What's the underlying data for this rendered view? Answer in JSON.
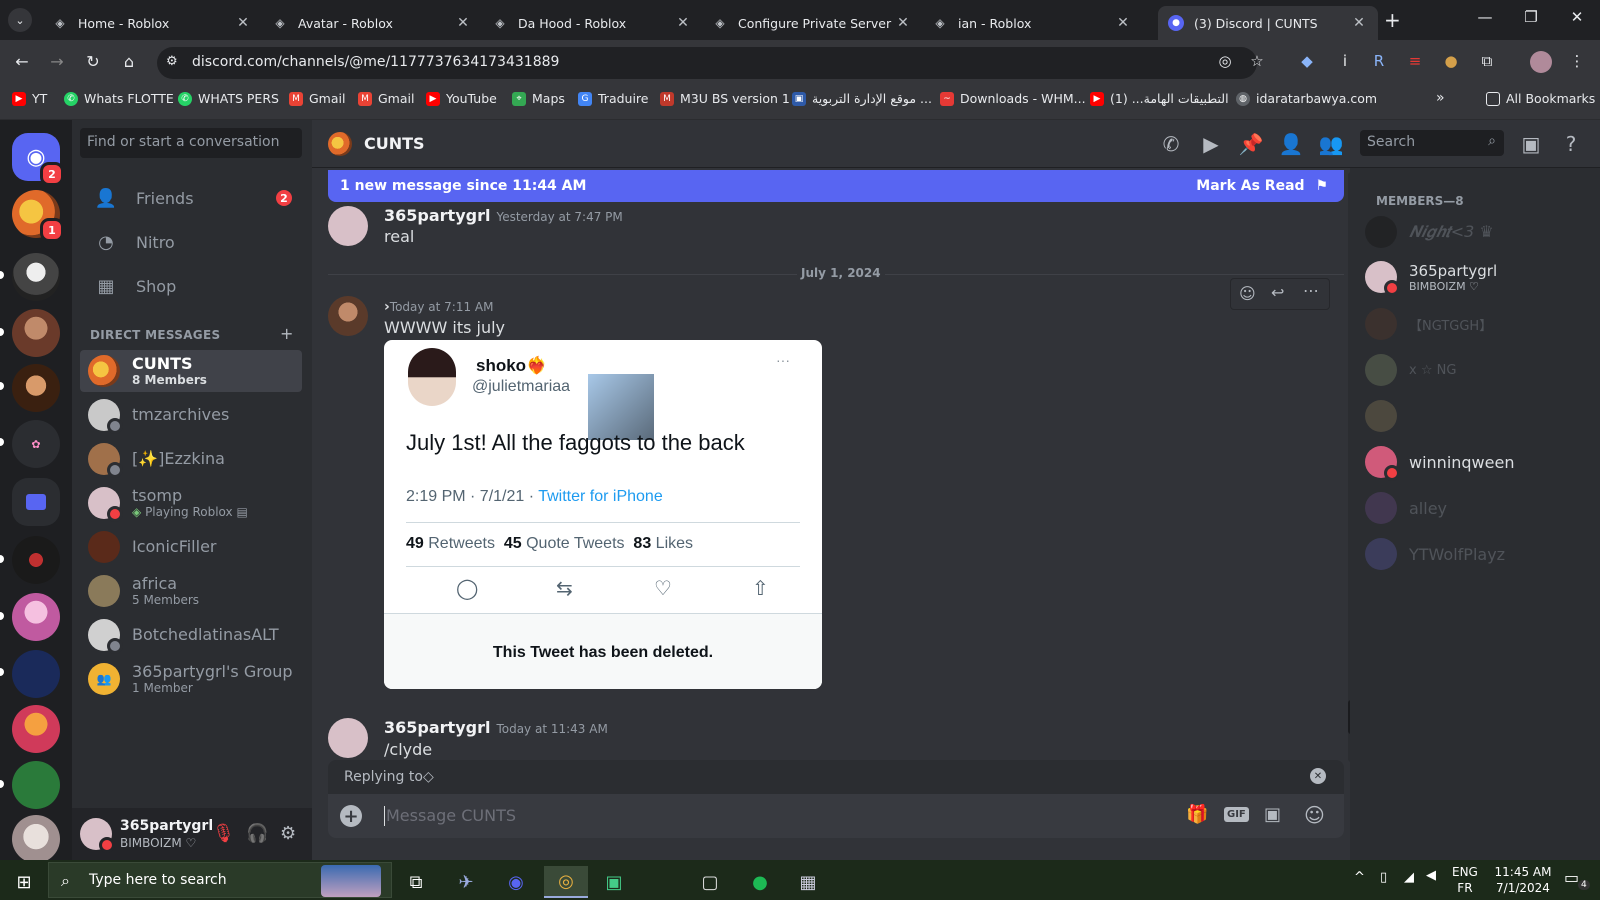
{
  "browser": {
    "tabs": [
      {
        "title": "Home - Roblox",
        "icon": "roblox-icon"
      },
      {
        "title": "Avatar - Roblox",
        "icon": "roblox-icon"
      },
      {
        "title": "Da Hood - Roblox",
        "icon": "roblox-icon"
      },
      {
        "title": "Configure Private Server - Ro",
        "icon": "roblox-icon"
      },
      {
        "title": "ian - Roblox",
        "icon": "roblox-icon"
      },
      {
        "title": "(3) Discord | CUNTS",
        "icon": "discord-icon",
        "active": true
      }
    ],
    "new_tab": "+",
    "url": "discord.com/channels/@me/1177737634173431889",
    "bookmarks": [
      {
        "label": "YT",
        "color": "#ff0000"
      },
      {
        "label": "Whats FLOTTE",
        "color": "#25d366"
      },
      {
        "label": "WHATS  PERS",
        "color": "#25d366"
      },
      {
        "label": "Gmail",
        "color": "#ea4335"
      },
      {
        "label": "Gmail",
        "color": "#ea4335"
      },
      {
        "label": "YouTube",
        "color": "#ff0000"
      },
      {
        "label": "Maps",
        "color": "#34a853"
      },
      {
        "label": "Traduire",
        "color": "#4285f4"
      },
      {
        "label": "M3U BS version 1",
        "color": "#c0392b"
      },
      {
        "label": "موقع الإدارة التربوية ...",
        "color": "#2e5aa8"
      },
      {
        "label": "Downloads - WHM...",
        "color": "#e53935"
      },
      {
        "label": "التطبيقات الهامة... (1)",
        "color": "#ff0000"
      },
      {
        "label": "idaratarbawya.com",
        "color": "#9aa0a6"
      }
    ],
    "all_bookmarks": "All Bookmarks"
  },
  "guilds": {
    "home_badge": "2",
    "server_badge": "1"
  },
  "dm_sidebar": {
    "search_placeholder": "Find or start a conversation",
    "nav": [
      {
        "label": "Friends",
        "icon": "friends-icon",
        "badge": "2"
      },
      {
        "label": "Nitro",
        "icon": "nitro-icon"
      },
      {
        "label": "Shop",
        "icon": "shop-icon"
      }
    ],
    "header": "DIRECT MESSAGES",
    "add": "+",
    "dms": [
      {
        "name": "CUNTS",
        "sub": "8 Members",
        "selected": true,
        "color": "#e8903a"
      },
      {
        "name": "tmzarchives",
        "sub": "",
        "color": "#c9c9c9",
        "status": "#80848e"
      },
      {
        "name": "[✨]Ezzkina",
        "sub": "",
        "color": "#a0704a",
        "status": "#80848e"
      },
      {
        "name": "tsomp",
        "sub": "Playing Roblox",
        "color": "#d8c0c8",
        "status": "#f23f43"
      },
      {
        "name": "IconicFiller",
        "sub": "",
        "color": "#5a2a1a"
      },
      {
        "name": "africa",
        "sub": "5 Members",
        "color": "#8a7a5a"
      },
      {
        "name": "BotchedlatinasALT",
        "sub": "",
        "color": "#d0d0d0",
        "status": "#80848e"
      },
      {
        "name": "365partygrl's Group",
        "sub": "1 Member",
        "color": "#f0b232"
      }
    ]
  },
  "user_panel": {
    "name": "365partygrl",
    "status": "BIMBOIZM ♡"
  },
  "chat": {
    "channel": "CUNTS",
    "search_placeholder": "Search",
    "banner_text": "1 new message since 11:44 AM",
    "mark_read": "Mark As Read",
    "date_divider": "July 1, 2024",
    "messages": [
      {
        "author": "365partygrl",
        "time": "Yesterday at 7:47 PM",
        "text": "real"
      },
      {
        "author": "",
        "time": "Today at 7:11 AM",
        "text": "WWWW its july"
      },
      {
        "author": "365partygrl",
        "time": "Today at 11:43 AM",
        "text": "/clyde"
      }
    ],
    "tweet": {
      "display_name": "shoko❤️‍🔥",
      "handle": "@julietmariaa",
      "body": "July 1st! All the faggots to the back",
      "meta_time": "2:19 PM · 7/1/21 · ",
      "meta_source": "Twitter for iPhone",
      "retweets_num": "49",
      "retweets_label": "Retweets",
      "quotes_num": "45",
      "quotes_label": "Quote Tweets",
      "likes_num": "83",
      "likes_label": "Likes",
      "deleted_text": "This Tweet has been deleted."
    },
    "reply_label": "Replying to",
    "composer_placeholder": "Message CUNTS"
  },
  "members": {
    "header": "MEMBERS—8",
    "list": [
      {
        "name": "𝑵𝒊𝒈𝒉𝒕<3 ♛",
        "sub": "",
        "state": "off",
        "color": "#111111"
      },
      {
        "name": "365partygrl",
        "sub": "BIMBOIZM ♡",
        "state": "on",
        "color": "#d8c0c8",
        "status": "#f23f43"
      },
      {
        "name": "【NGTGGH】",
        "sub": "",
        "state": "off",
        "color": "#5a3a2a"
      },
      {
        "name": "x ☆ NG",
        "sub": "",
        "state": "off",
        "color": "#7a8a6a"
      },
      {
        "name": "",
        "sub": "",
        "state": "off",
        "color": "#8a7a5a"
      },
      {
        "name": "winninqween",
        "sub": "",
        "state": "on",
        "color": "#d05a7a",
        "status": "#f23f43"
      },
      {
        "name": "alley",
        "sub": "",
        "state": "off",
        "color": "#6a4a8a"
      },
      {
        "name": "YTWolfPlayz",
        "sub": "",
        "state": "off",
        "color": "#5a5aaa"
      }
    ]
  },
  "taskbar": {
    "search_placeholder": "Type here to search",
    "lang_top": "ENG",
    "lang_bottom": "FR",
    "time": "11:45 AM",
    "date": "7/1/2024",
    "notif": "4"
  }
}
